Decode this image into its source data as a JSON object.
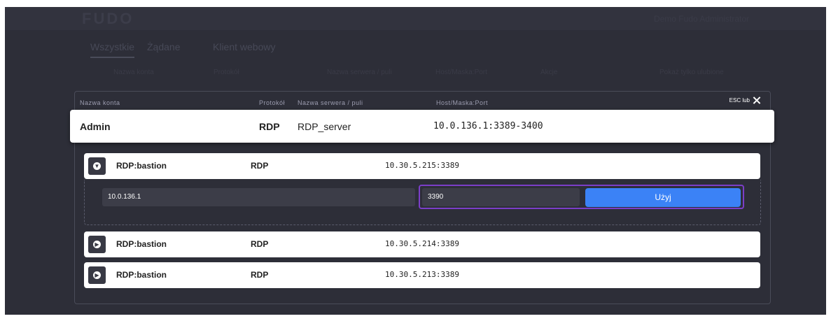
{
  "app": {
    "logo": "FUDO",
    "top_right": "Demo Fudo Administrator"
  },
  "tabs": [
    {
      "label": "Wszystkie"
    },
    {
      "label": "Żądane"
    },
    {
      "label": "Klient webowy"
    }
  ],
  "filters": [
    {
      "label": "Nazwa konta"
    },
    {
      "label": "Protokół"
    },
    {
      "label": "Nazwa serwera / puli"
    },
    {
      "label": "Host/Maska:Port"
    },
    {
      "label": "Akcje"
    },
    {
      "label": "Pokaż tylko ulubione"
    }
  ],
  "modal": {
    "esc_label": "ESC lub",
    "close_icon": "close-icon",
    "columns": {
      "account": "Nazwa konta",
      "protocol": "Protokół",
      "server": "Nazwa serwera / puli",
      "host": "Host/Maska:Port"
    },
    "main_row": {
      "account": "Admin",
      "protocol": "RDP",
      "server": "RDP_server",
      "host": "10.0.136.1:3389-3400"
    },
    "bastions": [
      {
        "name": "RDP:bastion",
        "protocol": "RDP",
        "address": "10.30.5.215:3389",
        "expanded": true,
        "icon": "chevron-down-circle-icon"
      },
      {
        "name": "RDP:bastion",
        "protocol": "RDP",
        "address": "10.30.5.214:3389",
        "expanded": false,
        "icon": "chevron-right-circle-icon"
      },
      {
        "name": "RDP:bastion",
        "protocol": "RDP",
        "address": "10.30.5.213:3389",
        "expanded": false,
        "icon": "chevron-right-circle-icon"
      }
    ],
    "connect": {
      "host_value": "10.0.136.1",
      "port_value": "3390",
      "use_label": "Użyj"
    }
  },
  "colors": {
    "background": "#2d2e38",
    "accent": "#3b82f6",
    "focus": "#7b3ec8"
  }
}
